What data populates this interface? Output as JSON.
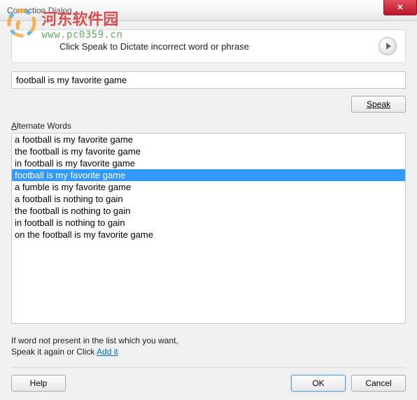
{
  "window": {
    "title": "Correction Dialog",
    "close_label": "✕"
  },
  "watermark": {
    "title": "河东软件园",
    "url": "www.pc0359.cn"
  },
  "instruction": {
    "text": "Click Speak to Dictate incorrect word or phrase"
  },
  "input": {
    "value": "football is my favorite game"
  },
  "buttons": {
    "speak": "Speak",
    "help": "Help",
    "ok": "OK",
    "cancel": "Cancel"
  },
  "alternates": {
    "label_pre": "A",
    "label_rest": "lternate Words",
    "items": [
      {
        "text": "a football is my favorite game",
        "selected": false
      },
      {
        "text": "the football is my favorite game",
        "selected": false
      },
      {
        "text": "in football is my favorite game",
        "selected": false
      },
      {
        "text": "football is my favorite game",
        "selected": true
      },
      {
        "text": "a fumble is my favorite game",
        "selected": false
      },
      {
        "text": "a football is nothing to gain",
        "selected": false
      },
      {
        "text": "the football is nothing to gain",
        "selected": false
      },
      {
        "text": "in football is nothing to gain",
        "selected": false
      },
      {
        "text": "on the football is my favorite game",
        "selected": false
      }
    ]
  },
  "footer": {
    "line1": "If word not present in the list which you want,",
    "line2_pre": "Speak it again or Click ",
    "add_link": "Add it"
  }
}
